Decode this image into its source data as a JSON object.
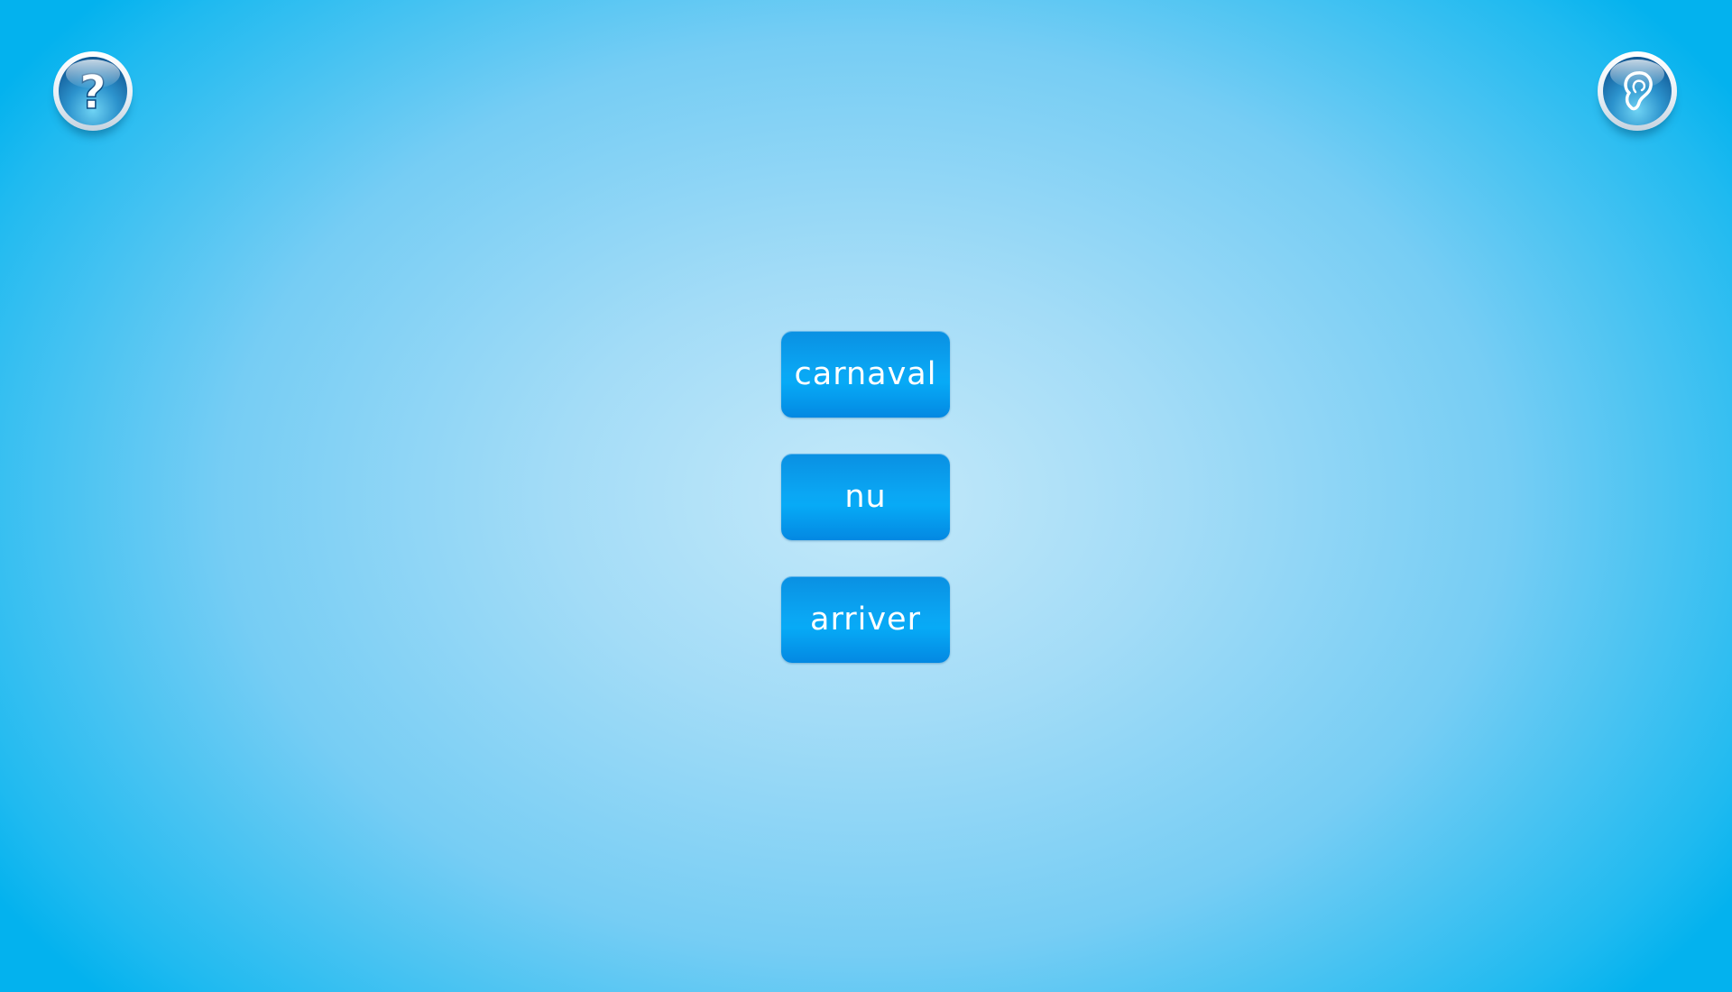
{
  "controls": {
    "help": {
      "icon": "question-mark-icon",
      "glyph": "?"
    },
    "listen": {
      "icon": "ear-icon"
    }
  },
  "choices": [
    {
      "label": "carnaval"
    },
    {
      "label": "nu"
    },
    {
      "label": "arriver"
    }
  ],
  "colors": {
    "button_blue": "#0aa7f4",
    "background_light": "#c4e9fa",
    "background_edge": "#03b2ee",
    "icon_blue": "#135d99"
  }
}
